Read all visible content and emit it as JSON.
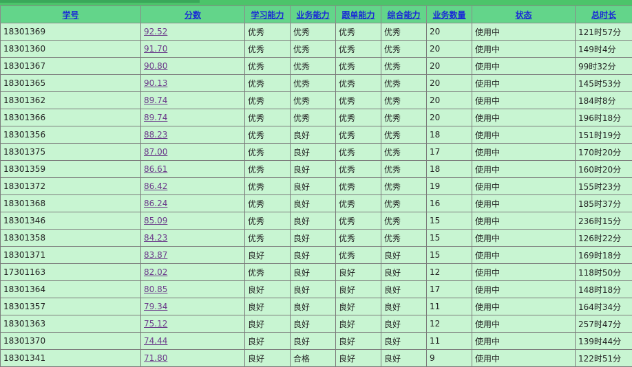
{
  "table": {
    "headers": [
      "学号",
      "分数",
      "学习能力",
      "业务能力",
      "跟单能力",
      "综合能力",
      "业务数量",
      "状态",
      "总时长"
    ],
    "rows": [
      {
        "id": "18301369",
        "score": "92.52",
        "learn": "优秀",
        "biz": "优秀",
        "follow": "优秀",
        "overall": "优秀",
        "count": "20",
        "status": "使用中",
        "time": "121时57分"
      },
      {
        "id": "18301360",
        "score": "91.70",
        "learn": "优秀",
        "biz": "优秀",
        "follow": "优秀",
        "overall": "优秀",
        "count": "20",
        "status": "使用中",
        "time": "149时4分"
      },
      {
        "id": "18301367",
        "score": "90.80",
        "learn": "优秀",
        "biz": "优秀",
        "follow": "优秀",
        "overall": "优秀",
        "count": "20",
        "status": "使用中",
        "time": "99时32分"
      },
      {
        "id": "18301365",
        "score": "90.13",
        "learn": "优秀",
        "biz": "优秀",
        "follow": "优秀",
        "overall": "优秀",
        "count": "20",
        "status": "使用中",
        "time": "145时53分"
      },
      {
        "id": "18301362",
        "score": "89.74",
        "learn": "优秀",
        "biz": "优秀",
        "follow": "优秀",
        "overall": "优秀",
        "count": "20",
        "status": "使用中",
        "time": "184时8分"
      },
      {
        "id": "18301366",
        "score": "89.74",
        "learn": "优秀",
        "biz": "优秀",
        "follow": "优秀",
        "overall": "优秀",
        "count": "20",
        "status": "使用中",
        "time": "196时18分"
      },
      {
        "id": "18301356",
        "score": "88.23",
        "learn": "优秀",
        "biz": "良好",
        "follow": "优秀",
        "overall": "优秀",
        "count": "18",
        "status": "使用中",
        "time": "151时19分"
      },
      {
        "id": "18301375",
        "score": "87.00",
        "learn": "优秀",
        "biz": "良好",
        "follow": "优秀",
        "overall": "优秀",
        "count": "17",
        "status": "使用中",
        "time": "170时20分"
      },
      {
        "id": "18301359",
        "score": "86.61",
        "learn": "优秀",
        "biz": "良好",
        "follow": "优秀",
        "overall": "优秀",
        "count": "18",
        "status": "使用中",
        "time": "160时20分"
      },
      {
        "id": "18301372",
        "score": "86.42",
        "learn": "优秀",
        "biz": "良好",
        "follow": "优秀",
        "overall": "优秀",
        "count": "19",
        "status": "使用中",
        "time": "155时23分"
      },
      {
        "id": "18301368",
        "score": "86.24",
        "learn": "优秀",
        "biz": "良好",
        "follow": "优秀",
        "overall": "优秀",
        "count": "16",
        "status": "使用中",
        "time": "185时37分"
      },
      {
        "id": "18301346",
        "score": "85.09",
        "learn": "优秀",
        "biz": "良好",
        "follow": "优秀",
        "overall": "优秀",
        "count": "15",
        "status": "使用中",
        "time": "236时15分"
      },
      {
        "id": "18301358",
        "score": "84.23",
        "learn": "优秀",
        "biz": "良好",
        "follow": "优秀",
        "overall": "优秀",
        "count": "15",
        "status": "使用中",
        "time": "126时22分"
      },
      {
        "id": "18301371",
        "score": "83.87",
        "learn": "良好",
        "biz": "良好",
        "follow": "优秀",
        "overall": "良好",
        "count": "15",
        "status": "使用中",
        "time": "169时18分"
      },
      {
        "id": "17301163",
        "score": "82.02",
        "learn": "优秀",
        "biz": "良好",
        "follow": "良好",
        "overall": "良好",
        "count": "12",
        "status": "使用中",
        "time": "118时50分"
      },
      {
        "id": "18301364",
        "score": "80.85",
        "learn": "良好",
        "biz": "良好",
        "follow": "良好",
        "overall": "良好",
        "count": "17",
        "status": "使用中",
        "time": "148时18分"
      },
      {
        "id": "18301357",
        "score": "79.34",
        "learn": "良好",
        "biz": "良好",
        "follow": "良好",
        "overall": "良好",
        "count": "11",
        "status": "使用中",
        "time": "164时34分"
      },
      {
        "id": "18301363",
        "score": "75.12",
        "learn": "良好",
        "biz": "良好",
        "follow": "良好",
        "overall": "良好",
        "count": "12",
        "status": "使用中",
        "time": "257时47分"
      },
      {
        "id": "18301370",
        "score": "74.44",
        "learn": "良好",
        "biz": "良好",
        "follow": "良好",
        "overall": "良好",
        "count": "11",
        "status": "使用中",
        "time": "139时44分"
      },
      {
        "id": "18301341",
        "score": "71.80",
        "learn": "良好",
        "biz": "合格",
        "follow": "良好",
        "overall": "良好",
        "count": "9",
        "status": "使用中",
        "time": "122时51分"
      }
    ]
  }
}
